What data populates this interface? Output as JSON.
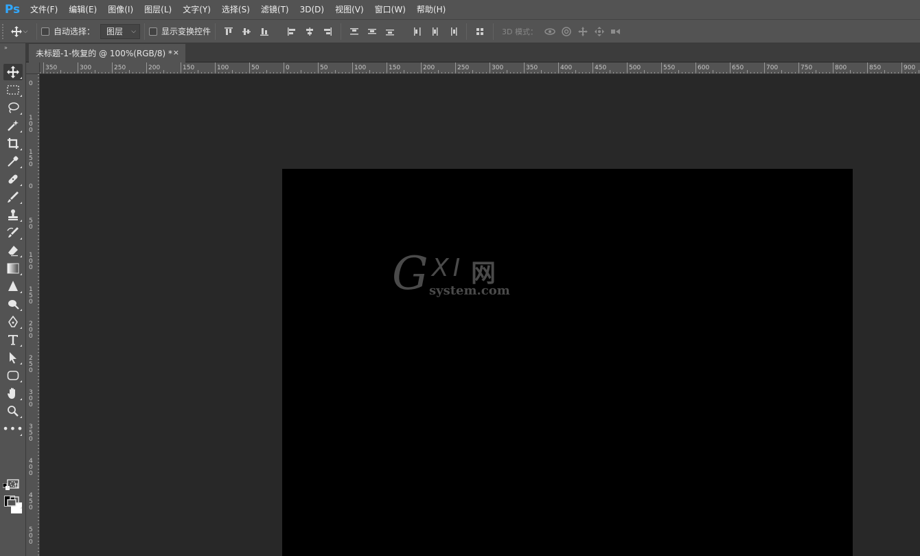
{
  "app": {
    "logo": "Ps",
    "menu": [
      "文件(F)",
      "编辑(E)",
      "图像(I)",
      "图层(L)",
      "文字(Y)",
      "选择(S)",
      "滤镜(T)",
      "3D(D)",
      "视图(V)",
      "窗口(W)",
      "帮助(H)"
    ]
  },
  "options": {
    "auto_select_label": "自动选择：",
    "auto_select_checked": false,
    "target_value": "图层",
    "show_transform_label": "显示变换控件",
    "show_transform_checked": false,
    "mode3d_label": "3D 模式："
  },
  "document": {
    "tab_title": "未标题-1-恢复的 @ 100%(RGB/8) *",
    "close_glyph": "×",
    "canvas_color": "#000000"
  },
  "ruler": {
    "h_labels": [
      "350",
      "300",
      "250",
      "200",
      "150",
      "100",
      "50",
      "0",
      "50",
      "100",
      "150",
      "200",
      "250",
      "300",
      "350",
      "400",
      "450",
      "500",
      "550",
      "600",
      "650",
      "700",
      "750",
      "800",
      "850",
      "900"
    ],
    "v_labels": [
      "0",
      "100",
      "150",
      "0",
      "50",
      "100",
      "150",
      "200",
      "250",
      "300",
      "350",
      "400",
      "450",
      "500"
    ]
  },
  "watermark": {
    "g": "G",
    "xi": "XI",
    "net": "网",
    "domain": "system.com"
  },
  "colors": {
    "foreground": "#000000",
    "background": "#ffffff",
    "accent": "#31a8ff"
  }
}
